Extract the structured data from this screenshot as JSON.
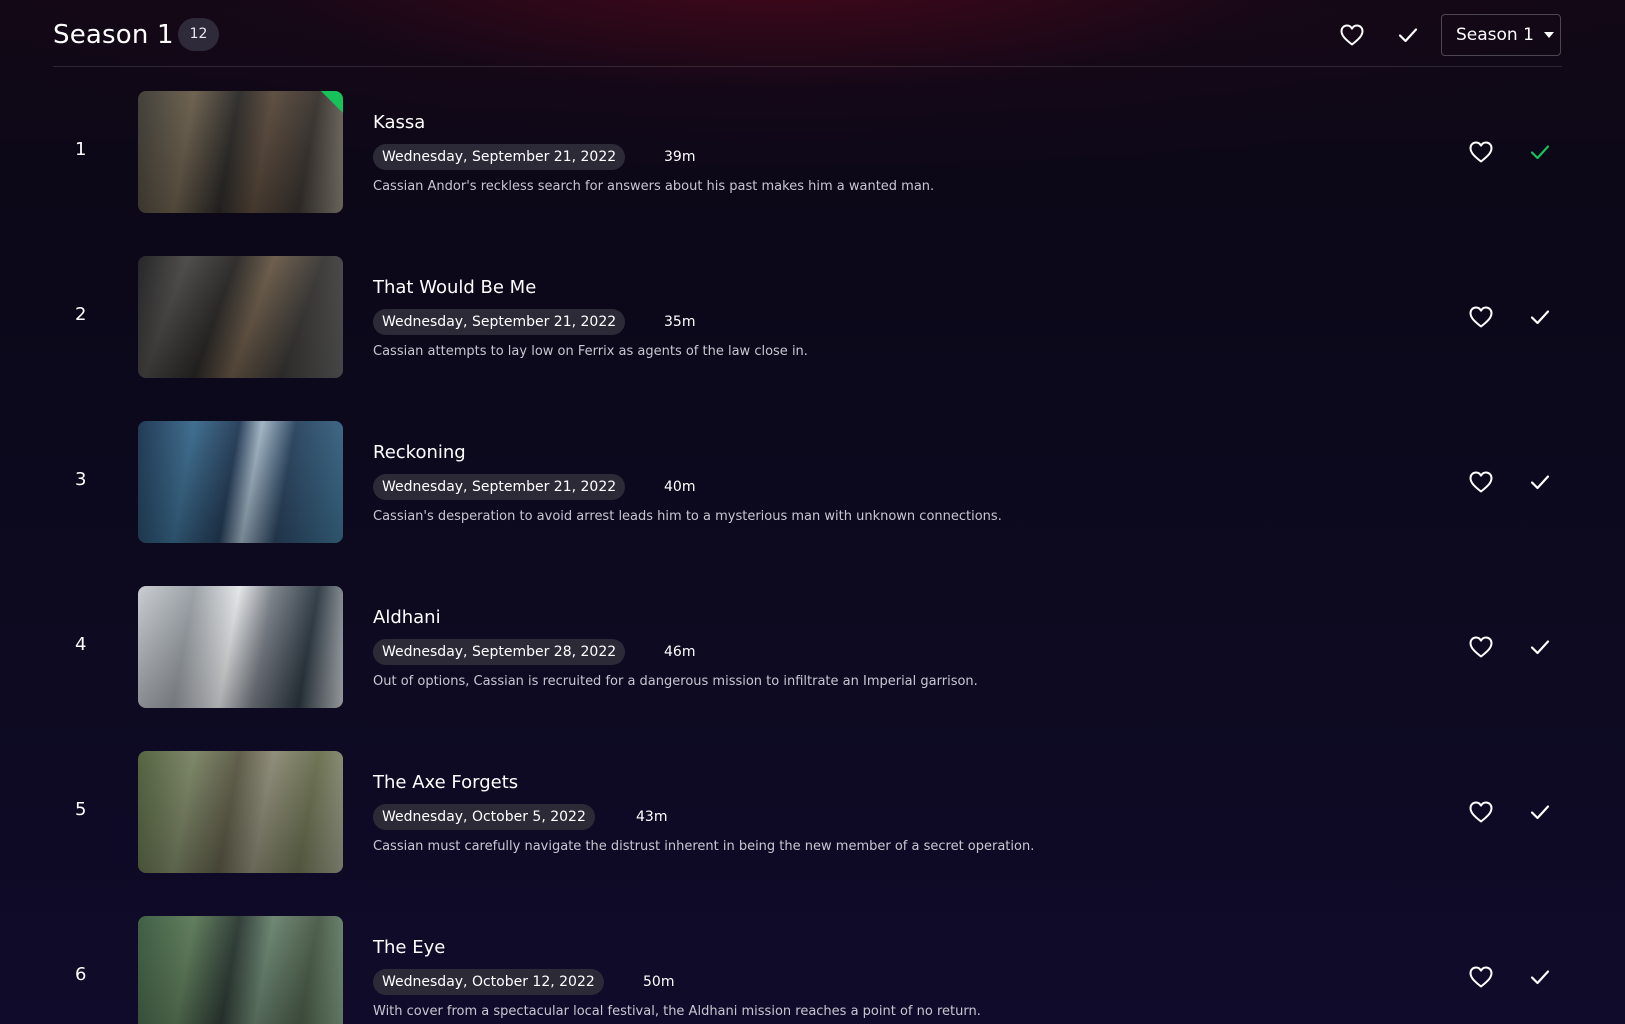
{
  "header": {
    "title": "Season 1",
    "episode_count": "12",
    "favorite_icon": "heart-outline-icon",
    "watched_icon": "check-icon",
    "season_select": {
      "selected": "Season 1"
    }
  },
  "colors": {
    "background": "#0b0818",
    "badge": "#2e2a3a",
    "watched_accent": "#18c25a"
  },
  "episodes": [
    {
      "number": "1",
      "title": "Kassa",
      "air_date": "Wednesday, September 21, 2022",
      "runtime": "39m",
      "description": "Cassian Andor's reckless search for answers about his past makes him a wanted man.",
      "watched": true
    },
    {
      "number": "2",
      "title": "That Would Be Me",
      "air_date": "Wednesday, September 21, 2022",
      "runtime": "35m",
      "description": "Cassian attempts to lay low on Ferrix as agents of the law close in.",
      "watched": false
    },
    {
      "number": "3",
      "title": "Reckoning",
      "air_date": "Wednesday, September 21, 2022",
      "runtime": "40m",
      "description": "Cassian's desperation to avoid arrest leads him to a mysterious man with unknown connections.",
      "watched": false
    },
    {
      "number": "4",
      "title": "Aldhani",
      "air_date": "Wednesday, September 28, 2022",
      "runtime": "46m",
      "description": "Out of options, Cassian is recruited for a dangerous mission to infiltrate an Imperial garrison.",
      "watched": false
    },
    {
      "number": "5",
      "title": "The Axe Forgets",
      "air_date": "Wednesday, October 5, 2022",
      "runtime": "43m",
      "description": "Cassian must carefully navigate the distrust inherent in being the new member of a secret operation.",
      "watched": false
    },
    {
      "number": "6",
      "title": "The Eye",
      "air_date": "Wednesday, October 12, 2022",
      "runtime": "50m",
      "description": "With cover from a spectacular local festival, the Aldhani mission reaches a point of no return.",
      "watched": false
    }
  ]
}
